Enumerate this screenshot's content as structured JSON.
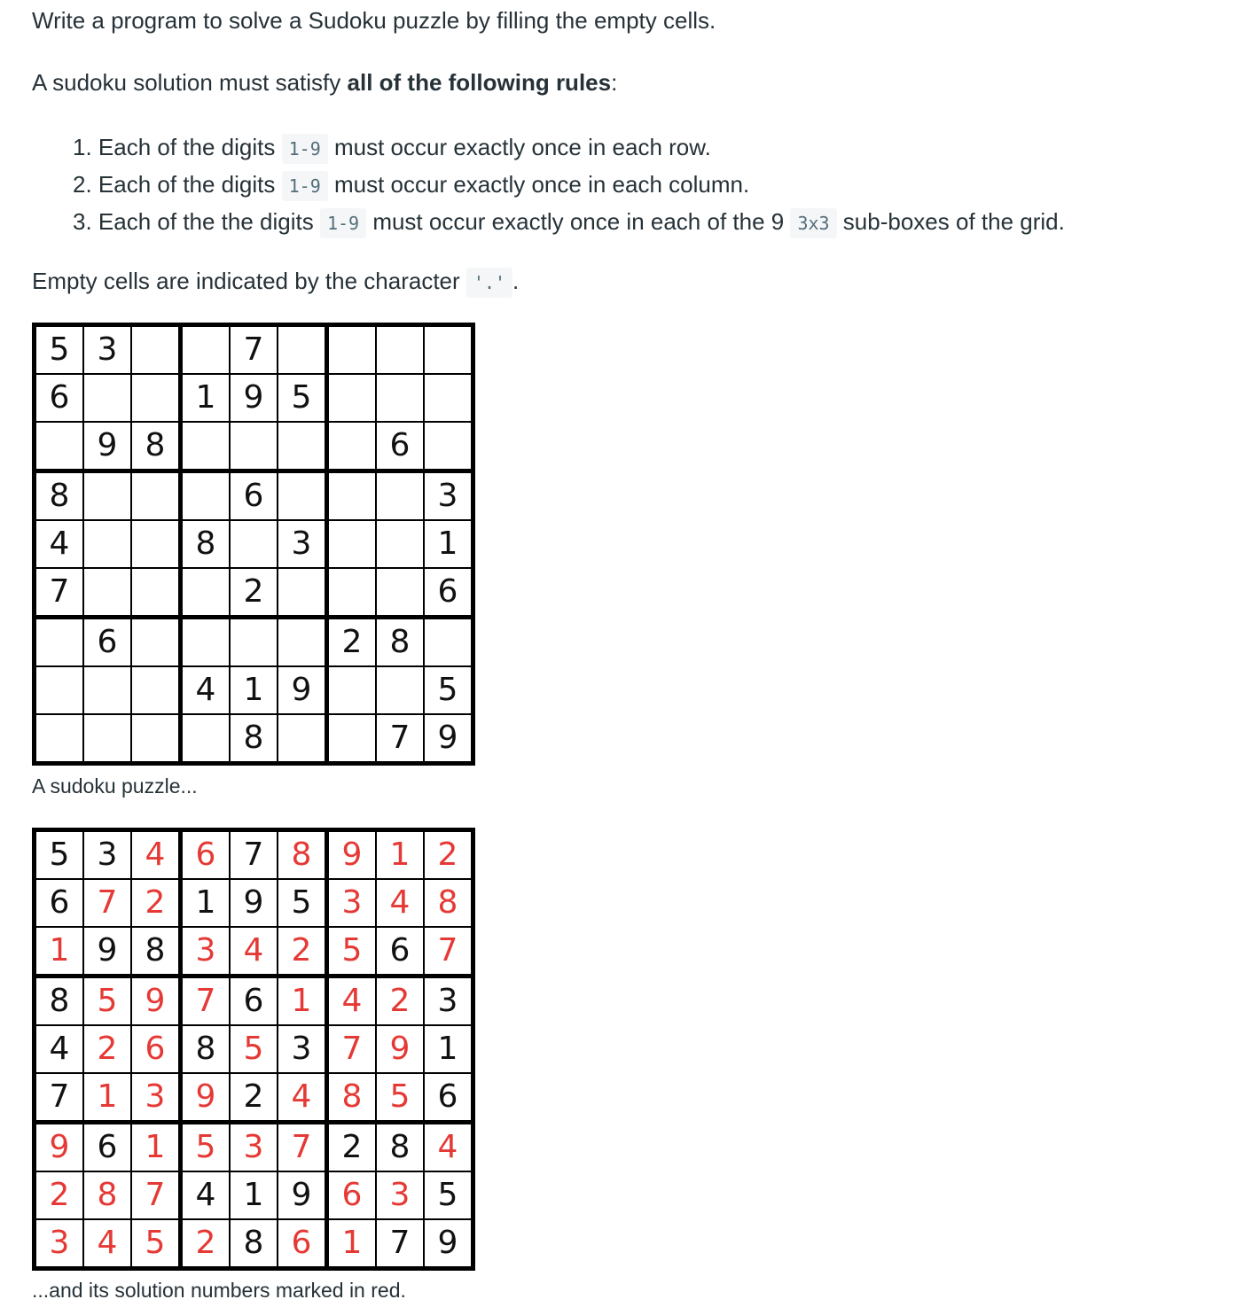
{
  "intro": "Write a program to solve a Sudoku puzzle by filling the empty cells.",
  "rules_intro": {
    "prefix": "A sudoku solution must satisfy ",
    "bold": "all of the following rules",
    "suffix": ":"
  },
  "rules": [
    {
      "number": "1.",
      "before": "Each of the digits ",
      "code": "1-9",
      "after": " must occur exactly once in each row."
    },
    {
      "number": "2.",
      "before": "Each of the digits ",
      "code": "1-9",
      "after": " must occur exactly once in each column."
    },
    {
      "number": "3.",
      "before": "Each of the the digits ",
      "code": "1-9",
      "mid": " must occur exactly once in each of the 9 ",
      "code2": "3x3",
      "after": " sub-boxes of the grid."
    }
  ],
  "empty_cells": {
    "prefix": "Empty cells are indicated by the character ",
    "code": "'.'",
    "suffix": "."
  },
  "puzzle": {
    "caption": "A sudoku puzzle...",
    "rows": [
      [
        "5",
        "3",
        "",
        "",
        "7",
        "",
        "",
        "",
        ""
      ],
      [
        "6",
        "",
        "",
        "1",
        "9",
        "5",
        "",
        "",
        ""
      ],
      [
        "",
        "9",
        "8",
        "",
        "",
        "",
        "",
        "6",
        ""
      ],
      [
        "8",
        "",
        "",
        "",
        "6",
        "",
        "",
        "",
        "3"
      ],
      [
        "4",
        "",
        "",
        "8",
        "",
        "3",
        "",
        "",
        "1"
      ],
      [
        "7",
        "",
        "",
        "",
        "2",
        "",
        "",
        "",
        "6"
      ],
      [
        "",
        "6",
        "",
        "",
        "",
        "",
        "2",
        "8",
        ""
      ],
      [
        "",
        "",
        "",
        "4",
        "1",
        "9",
        "",
        "",
        "5"
      ],
      [
        "",
        "",
        "",
        "",
        "8",
        "",
        "",
        "7",
        "9"
      ]
    ]
  },
  "solution": {
    "caption": "...and its solution numbers marked in red.",
    "rows": [
      [
        "5",
        "3",
        "4",
        "6",
        "7",
        "8",
        "9",
        "1",
        "2"
      ],
      [
        "6",
        "7",
        "2",
        "1",
        "9",
        "5",
        "3",
        "4",
        "8"
      ],
      [
        "1",
        "9",
        "8",
        "3",
        "4",
        "2",
        "5",
        "6",
        "7"
      ],
      [
        "8",
        "5",
        "9",
        "7",
        "6",
        "1",
        "4",
        "2",
        "3"
      ],
      [
        "4",
        "2",
        "6",
        "8",
        "5",
        "3",
        "7",
        "9",
        "1"
      ],
      [
        "7",
        "1",
        "3",
        "9",
        "2",
        "4",
        "8",
        "5",
        "6"
      ],
      [
        "9",
        "6",
        "1",
        "5",
        "3",
        "7",
        "2",
        "8",
        "4"
      ],
      [
        "2",
        "8",
        "7",
        "4",
        "1",
        "9",
        "6",
        "3",
        "5"
      ],
      [
        "3",
        "4",
        "5",
        "2",
        "8",
        "6",
        "1",
        "7",
        "9"
      ]
    ],
    "solution_color": "#e53935"
  }
}
